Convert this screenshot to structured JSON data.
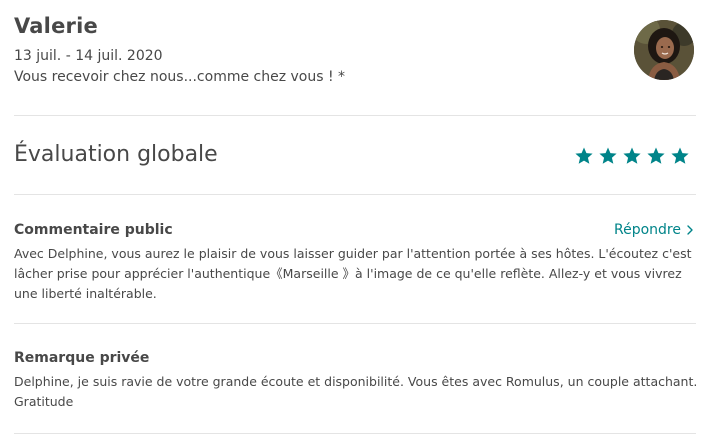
{
  "review": {
    "guest_name": "Valerie",
    "dates": "13 juil. - 14 juil. 2020",
    "listing_title": "Vous recevoir chez nous...comme chez vous ! *"
  },
  "overall": {
    "label": "Évaluation globale",
    "rating": 5,
    "max_rating": 5,
    "star_color": "#008489"
  },
  "public_comment": {
    "title": "Commentaire public",
    "reply_label": "Répondre",
    "text": "Avec Delphine, vous aurez le plaisir de vous laisser guider par l'attention portée à ses hôtes. L'écoutez c'est lâcher prise pour apprécier l'authentique《Marseille 》à l'image de ce qu'elle reflète. Allez-y et vous vivrez une liberté inaltérable."
  },
  "private_note": {
    "title": "Remarque privée",
    "text": "Delphine, je suis ravie de votre grande écoute et disponibilité. Vous êtes avec Romulus, un couple attachant. Gratitude"
  },
  "colors": {
    "accent": "#008489",
    "text": "#484848",
    "divider": "#e4e4e4"
  }
}
